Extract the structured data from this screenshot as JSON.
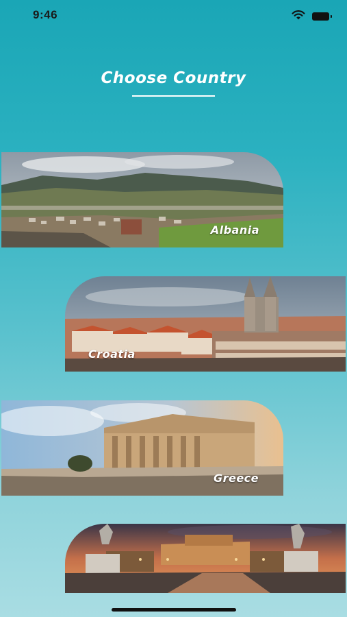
{
  "status_bar": {
    "time": "9:46",
    "icons": [
      "wifi-icon",
      "battery-icon"
    ]
  },
  "header": {
    "title": "Choose Country"
  },
  "countries": [
    {
      "label": "Albania"
    },
    {
      "label": "Croatia"
    },
    {
      "label": "Greece"
    },
    {
      "label": ""
    }
  ],
  "colors": {
    "background_top": "#1aa6b6",
    "background_bottom": "#a9dde3",
    "title_text": "#ffffff"
  }
}
